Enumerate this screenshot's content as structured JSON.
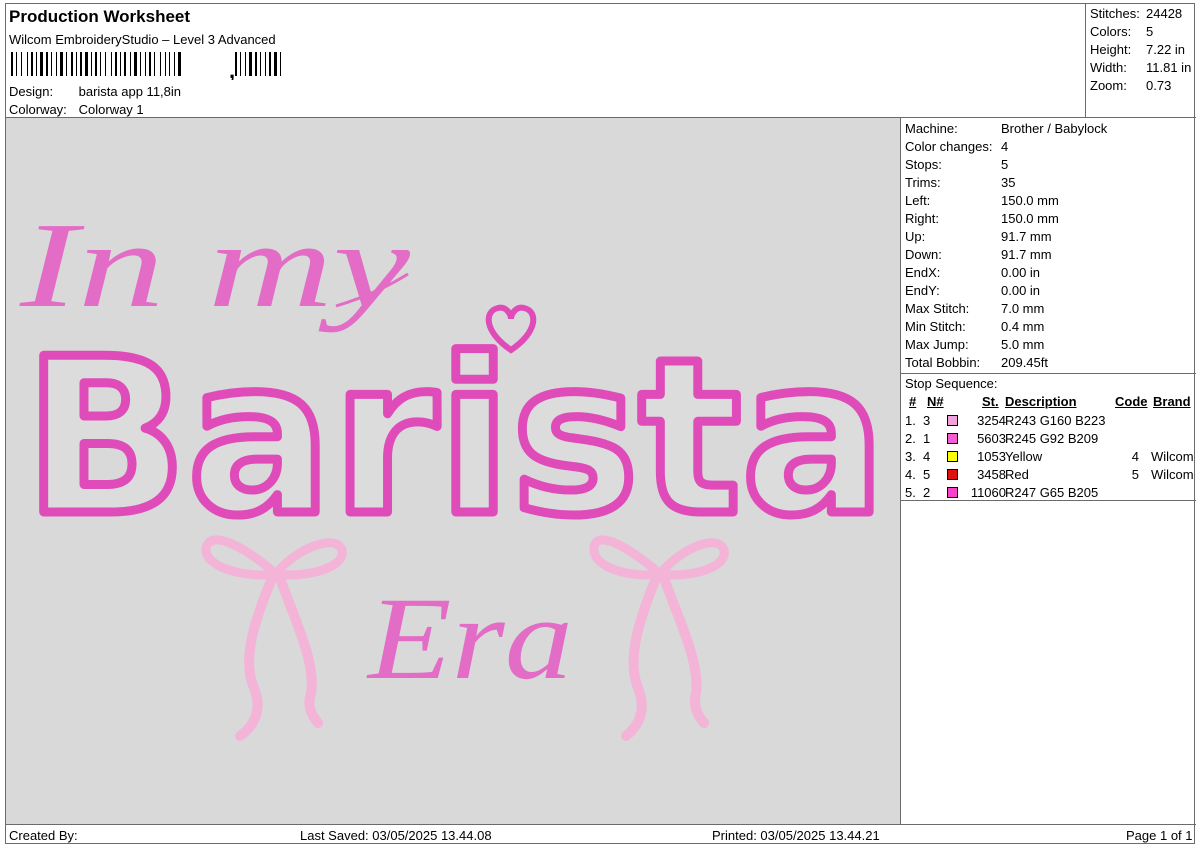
{
  "header": {
    "title": "Production Worksheet",
    "subtitle": "Wilcom EmbroideryStudio – Level 3 Advanced",
    "barcode_suffix": ",",
    "design_label": "Design:",
    "design_value": "barista app 11,8in",
    "colorway_label": "Colorway:",
    "colorway_value": "Colorway 1"
  },
  "stats": [
    {
      "label": "Stitches:",
      "value": "24428"
    },
    {
      "label": "Colors:",
      "value": "5"
    },
    {
      "label": "Height:",
      "value": "7.22 in"
    },
    {
      "label": "Width:",
      "value": "11.81 in"
    },
    {
      "label": "Zoom:",
      "value": "0.73"
    }
  ],
  "properties": [
    {
      "label": "Machine:",
      "value": "Brother / Babylock"
    },
    {
      "label": "Color changes:",
      "value": "4"
    },
    {
      "label": "Stops:",
      "value": "5"
    },
    {
      "label": "Trims:",
      "value": "35"
    },
    {
      "label": "Left:",
      "value": "150.0 mm"
    },
    {
      "label": "Right:",
      "value": "150.0 mm"
    },
    {
      "label": "Up:",
      "value": "91.7 mm"
    },
    {
      "label": "Down:",
      "value": "91.7 mm"
    },
    {
      "label": "EndX:",
      "value": "0.00 in"
    },
    {
      "label": "EndY:",
      "value": "0.00 in"
    },
    {
      "label": "Max Stitch:",
      "value": "7.0 mm"
    },
    {
      "label": "Min Stitch:",
      "value": "0.4 mm"
    },
    {
      "label": "Max Jump:",
      "value": "5.0 mm"
    },
    {
      "label": "Total Bobbin:",
      "value": "209.45ft"
    }
  ],
  "stop_sequence": {
    "title": "Stop Sequence:",
    "columns": {
      "num": "#",
      "n": "N#",
      "st": "St.",
      "description": "Description",
      "code": "Code",
      "brand": "Brand"
    },
    "rows": [
      {
        "num": "1.",
        "n": "3",
        "color": "#F3A0DF",
        "st": "3254",
        "description": "R243 G160 B223",
        "code": "",
        "brand": ""
      },
      {
        "num": "2.",
        "n": "1",
        "color": "#F55CD1",
        "st": "5603",
        "description": "R245 G92 B209",
        "code": "",
        "brand": ""
      },
      {
        "num": "3.",
        "n": "4",
        "color": "#FFFF00",
        "st": "1053",
        "description": "Yellow",
        "code": "4",
        "brand": "Wilcom"
      },
      {
        "num": "4.",
        "n": "5",
        "color": "#E01010",
        "st": "3458",
        "description": "Red",
        "code": "5",
        "brand": "Wilcom"
      },
      {
        "num": "5.",
        "n": "2",
        "color": "#F741CD",
        "st": "11060",
        "description": "R247 G65 B205",
        "code": "",
        "brand": ""
      }
    ]
  },
  "design": {
    "line1": "In my",
    "line2": "Barista",
    "line3": "Era",
    "colors": {
      "script": "#E26CC6",
      "outline": "#E04BBA",
      "fill": "#DCDCDC",
      "bow": "#F3B4D8"
    }
  },
  "footer": {
    "created_by": "Created By:",
    "last_saved": "Last Saved: 03/05/2025 13.44.08",
    "printed": "Printed: 03/05/2025 13.44.21",
    "page": "Page 1 of 1"
  }
}
